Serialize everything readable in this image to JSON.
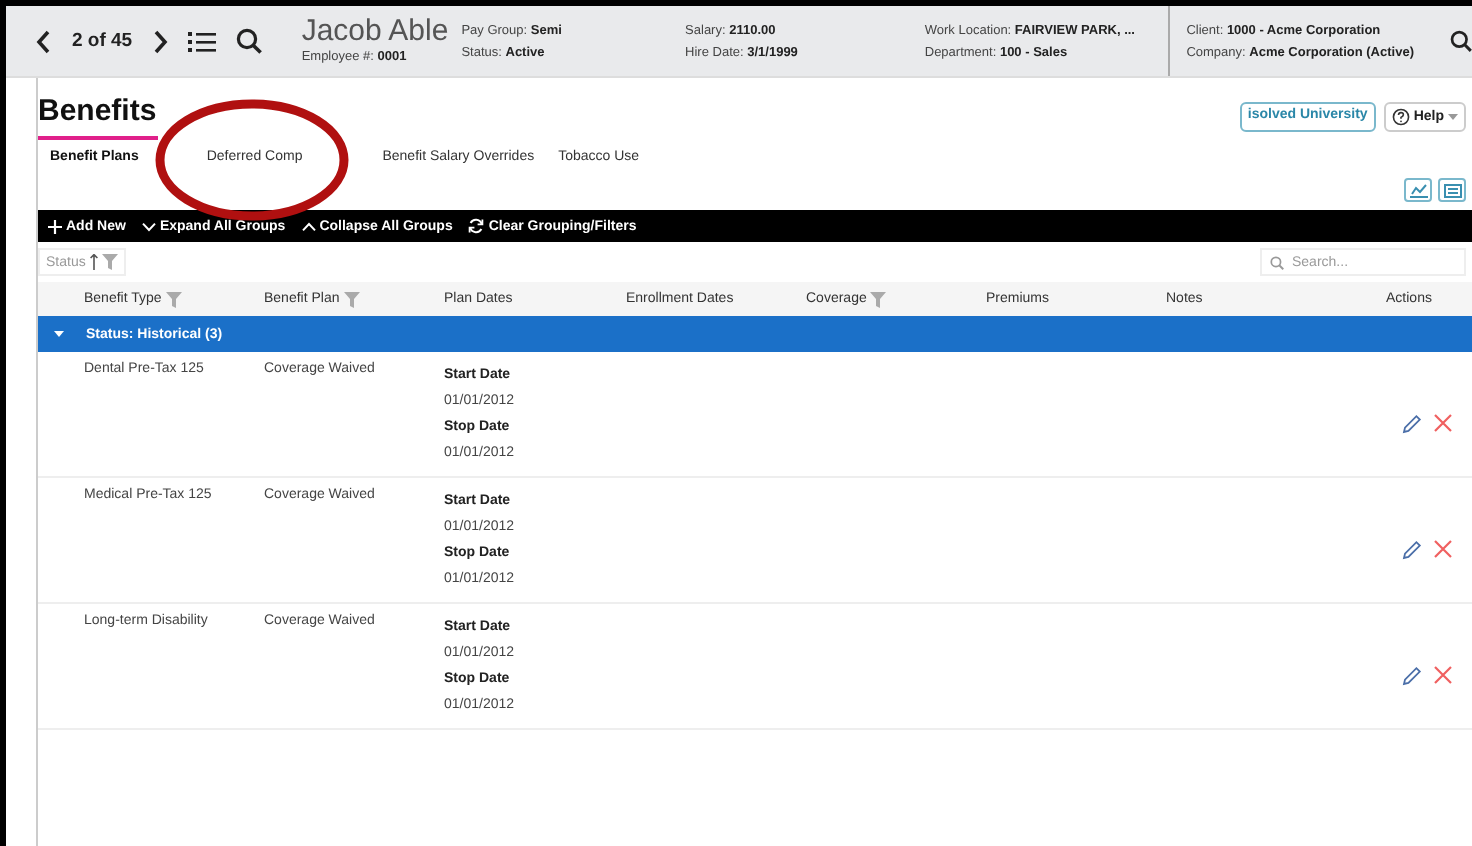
{
  "header": {
    "position": "2 of 45",
    "employee_name": "Jacob Able",
    "employee_number_label": "Employee #:",
    "employee_number": "0001",
    "field_columns": [
      [
        {
          "label": "Pay Group:",
          "value": "Semi"
        },
        {
          "label": "Status:",
          "value": "Active"
        }
      ],
      [
        {
          "label": "Salary:",
          "value": "2110.00"
        },
        {
          "label": "Hire Date:",
          "value": "3/1/1999"
        }
      ],
      [
        {
          "label": "Work Location:",
          "value": "FAIRVIEW PARK, ..."
        },
        {
          "label": "Department:",
          "value": "100 - Sales"
        }
      ],
      [
        {
          "label": "Client:",
          "value": "1000 - Acme Corporation"
        },
        {
          "label": "Company:",
          "value": "Acme Corporation (Active)"
        }
      ]
    ]
  },
  "page_title": "Benefits",
  "links": [
    {
      "label": "isolved University",
      "kind": "university"
    },
    {
      "label": "Help",
      "kind": "help"
    }
  ],
  "tabs": [
    {
      "label": "Benefit Plans",
      "selected": true
    },
    {
      "label": "Deferred Comp",
      "selected": false
    },
    {
      "label": "Benefit Salary Overrides",
      "selected": false
    },
    {
      "label": "Tobacco Use",
      "selected": false
    }
  ],
  "annotation": {
    "kind": "circle",
    "color": "#b01010"
  },
  "toolbar": [
    {
      "label": "Add New",
      "kind": "add"
    },
    {
      "label": "Expand All Groups",
      "kind": "expand"
    },
    {
      "label": "Collapse All Groups",
      "kind": "collapse"
    },
    {
      "label": "Clear Grouping/Filters",
      "kind": "refresh"
    }
  ],
  "grouping": {
    "label": "Status"
  },
  "search": {
    "placeholder": "Search..."
  },
  "columns": [
    {
      "label": "Benefit Type",
      "filter": true
    },
    {
      "label": "Benefit Plan",
      "filter": true
    },
    {
      "label": "Plan Dates",
      "filter": false
    },
    {
      "label": "Enrollment Dates",
      "filter": false
    },
    {
      "label": "Coverage",
      "filter": true
    },
    {
      "label": "Premiums",
      "filter": false
    },
    {
      "label": "Notes",
      "filter": false
    },
    {
      "label": "Actions",
      "filter": false
    }
  ],
  "group": {
    "label": "Status: Historical (3)",
    "expanded": true
  },
  "rows": [
    {
      "benefit_type": "Dental Pre-Tax 125",
      "benefit_plan": "Coverage Waived",
      "dates": [
        {
          "label": "Start Date",
          "value": "01/01/2012"
        },
        {
          "label": "Stop Date",
          "value": "01/01/2012"
        }
      ]
    },
    {
      "benefit_type": "Medical Pre-Tax 125",
      "benefit_plan": "Coverage Waived",
      "dates": [
        {
          "label": "Start Date",
          "value": "01/01/2012"
        },
        {
          "label": "Stop Date",
          "value": "01/01/2012"
        }
      ]
    },
    {
      "benefit_type": "Long-term Disability",
      "benefit_plan": "Coverage Waived",
      "dates": [
        {
          "label": "Start Date",
          "value": "01/01/2012"
        },
        {
          "label": "Stop Date",
          "value": "01/01/2012"
        }
      ]
    }
  ]
}
